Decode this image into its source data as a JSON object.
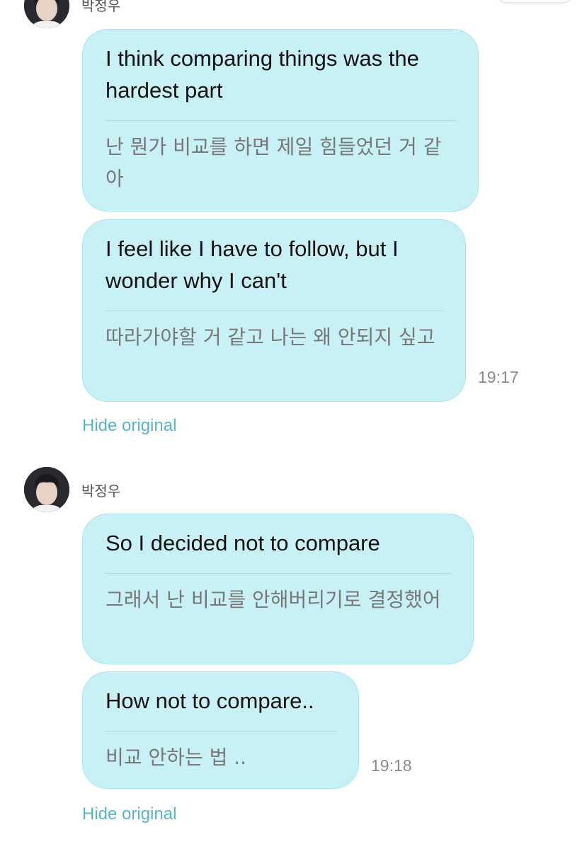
{
  "topbar": {
    "button_label": ""
  },
  "groups": [
    {
      "sender": "박정우",
      "messages": [
        {
          "translated": "I think comparing things was the hardest part",
          "original": "난 뭔가 비교를 하면 제일 힘들었던 거 같아"
        },
        {
          "translated": "I feel like I have to follow, but I wonder why I can't",
          "original": "따라가야할 거 같고 나는 왜 안되지 싶고",
          "time": "19:17"
        }
      ],
      "hide_label": "Hide original"
    },
    {
      "sender": "박정우",
      "messages": [
        {
          "translated": "So I decided not to compare",
          "original": "그래서 난 비교를 안해버리기로 결정했어"
        },
        {
          "translated": "How not to compare..",
          "original": "비교 안하는 법 ..",
          "time": "19:18"
        }
      ],
      "hide_label": "Hide original"
    }
  ],
  "colors": {
    "bubble": "#c8f1f6",
    "link": "#54b6c6",
    "timestamp": "#8a8a8a"
  },
  "icons": {
    "avatar": "profile-photo"
  }
}
